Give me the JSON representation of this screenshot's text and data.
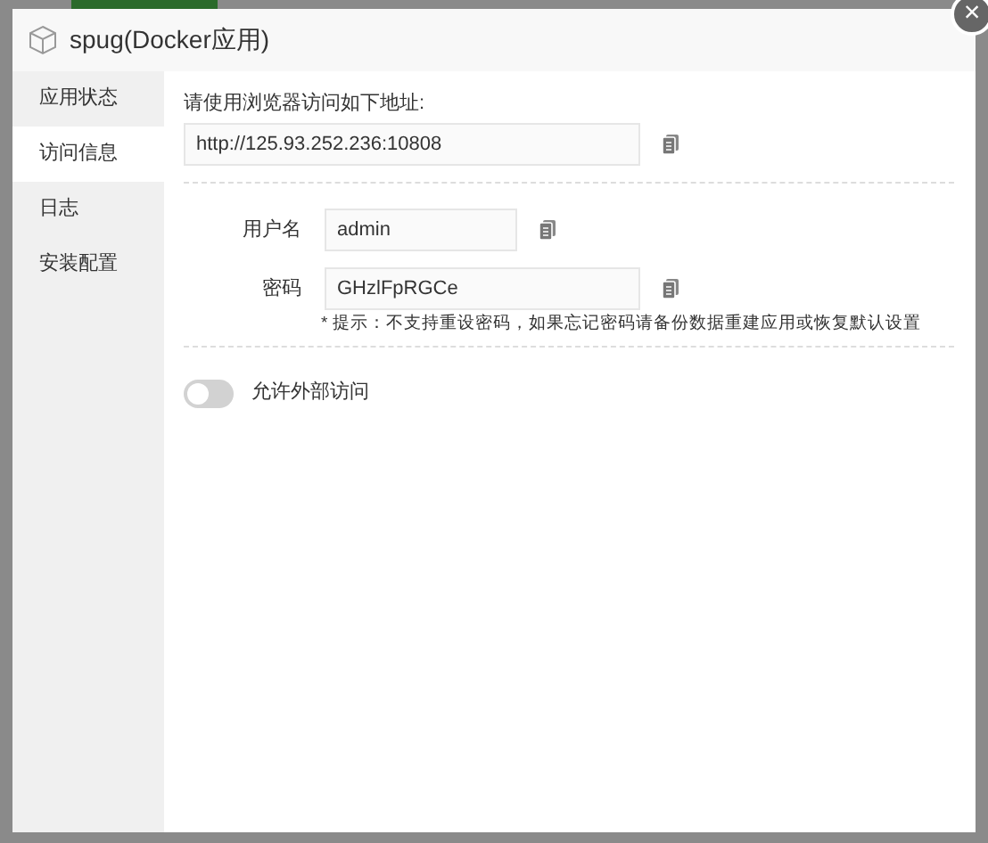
{
  "dialog": {
    "title": "spug(Docker应用)",
    "close": "×"
  },
  "sidebar": {
    "items": [
      {
        "label": "应用状态",
        "selected": false
      },
      {
        "label": "访问信息",
        "selected": true
      },
      {
        "label": "日志",
        "selected": false
      },
      {
        "label": "安装配置",
        "selected": false
      }
    ]
  },
  "address": {
    "label": "请使用浏览器访问如下地址:",
    "value": "http://125.93.252.236:10808"
  },
  "credentials": [
    {
      "label": "用户名",
      "value": "admin"
    },
    {
      "label": "密码",
      "value": "GHzlFpRGCe"
    }
  ],
  "hint": "* 提示：不支持重设密码，如果忘记密码请备份数据重建应用或恢复默认设置",
  "external_access": {
    "label": "允许外部访问",
    "on": false
  }
}
